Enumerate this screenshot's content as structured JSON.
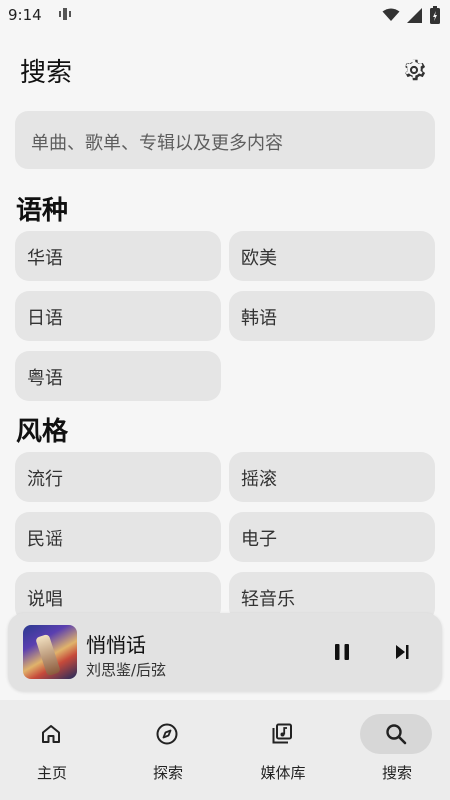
{
  "status_bar": {
    "time": "9:14"
  },
  "header": {
    "title": "搜索",
    "settings_icon": "gear-icon"
  },
  "search": {
    "placeholder": "单曲、歌单、专辑以及更多内容"
  },
  "sections": [
    {
      "title": "语种",
      "items": [
        "华语",
        "欧美",
        "日语",
        "韩语",
        "粤语"
      ]
    },
    {
      "title": "风格",
      "items": [
        "流行",
        "摇滚",
        "民谣",
        "电子",
        "说唱",
        "轻音乐"
      ]
    }
  ],
  "player": {
    "title": "悄悄话",
    "artist": "刘思鉴/后弦",
    "state": "playing"
  },
  "bottom_nav": {
    "active": "搜索",
    "items": [
      {
        "label": "主页",
        "icon": "home-icon"
      },
      {
        "label": "探索",
        "icon": "compass-icon"
      },
      {
        "label": "媒体库",
        "icon": "library-icon"
      },
      {
        "label": "搜索",
        "icon": "search-icon"
      }
    ]
  },
  "colors": {
    "background": "#f6f6f6",
    "chip": "#e5e5e5",
    "nav_background": "#ececec"
  }
}
